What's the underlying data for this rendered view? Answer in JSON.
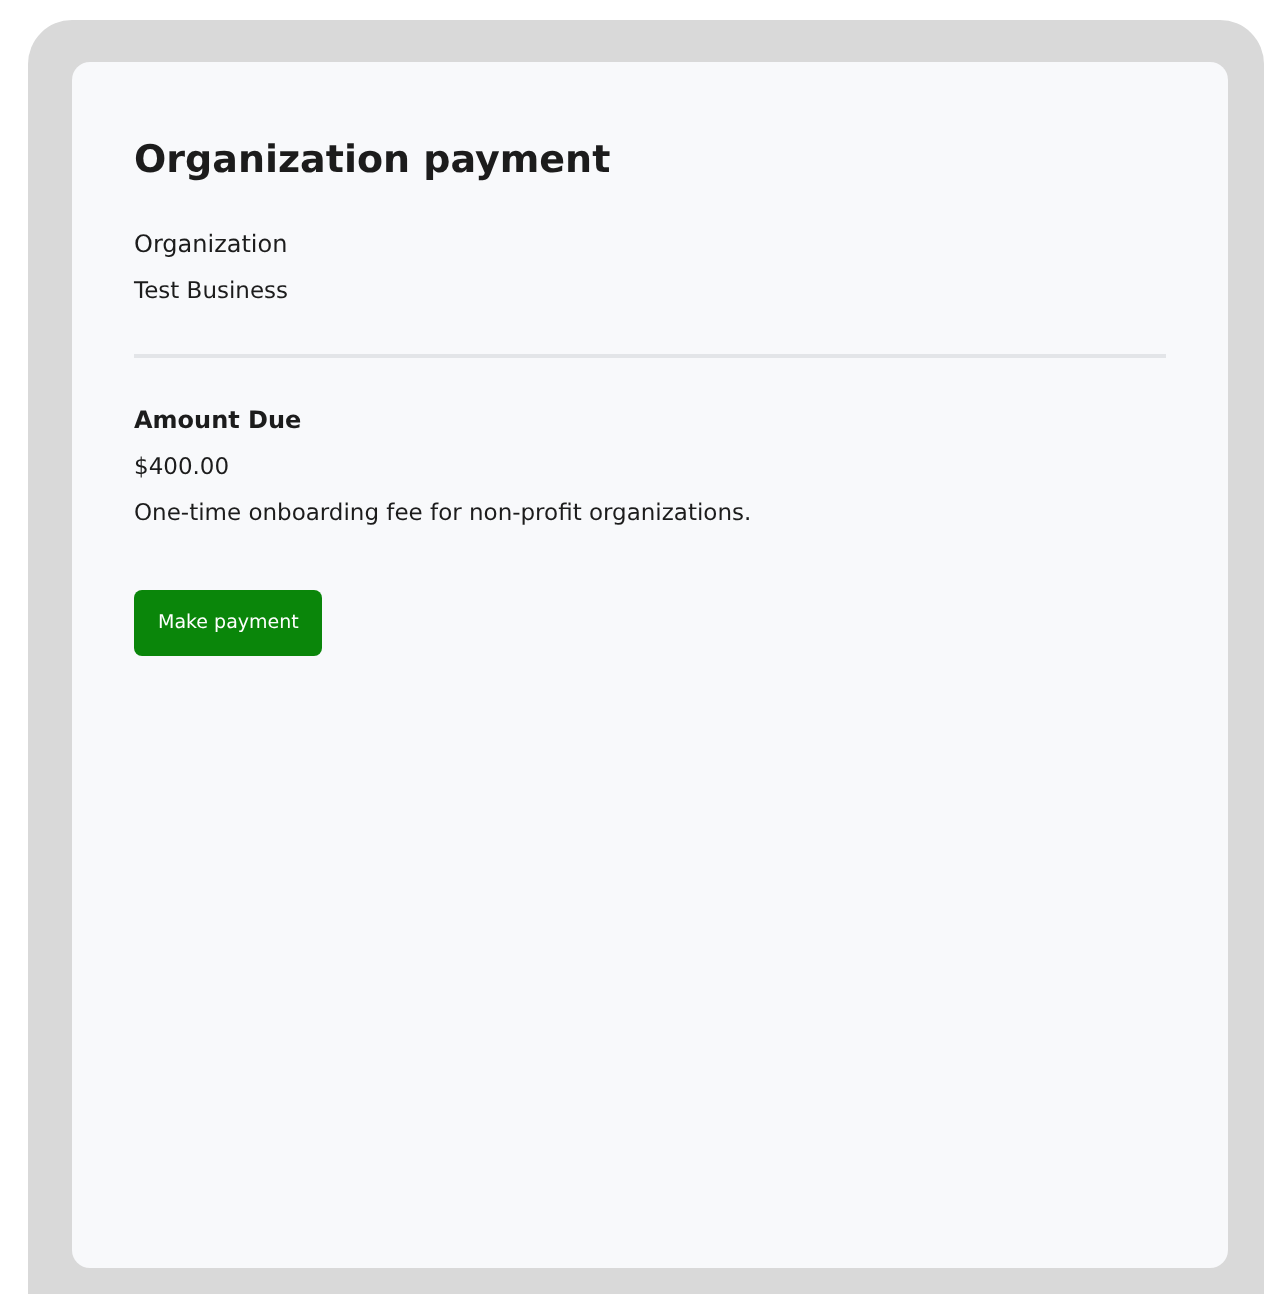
{
  "title": "Organization payment",
  "organization": {
    "label": "Organization",
    "value": "Test Business"
  },
  "amount": {
    "label": "Amount Due",
    "value": "$400.00",
    "description": "One-time onboarding fee for non-profit organizations."
  },
  "button": {
    "label": "Make payment"
  }
}
